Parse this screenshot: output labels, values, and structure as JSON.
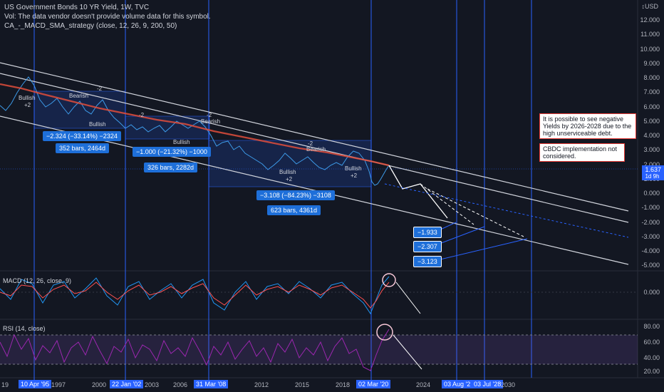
{
  "header": {
    "symbol_line": "US Government Bonds 10 YR Yield, 1W, TVC",
    "volume_line": "Vol: The data vendor doesn't provide volume data for this symbol.",
    "strategy_line": "CA_-_MACD_SMA_strategy (close, 12, 26, 9, 200, 50)"
  },
  "currency": "USD",
  "price_axis": [
    "12.000",
    "11.000",
    "10.000",
    "9.000",
    "8.000",
    "7.000",
    "6.000",
    "5.000",
    "4.000",
    "3.000",
    "2.000",
    "1.000",
    "0.000",
    "-1.000",
    "-2.000",
    "-3.000",
    "-4.000",
    "-5.000"
  ],
  "current_price": {
    "value": "1.637",
    "countdown": "1d 9h"
  },
  "macd": {
    "title": "MACD (12, 26, close, 9)",
    "axis_label": "0.000"
  },
  "rsi": {
    "title": "RSI (14, close)",
    "axis_labels": [
      "80.00",
      "60.00",
      "40.00",
      "20.00"
    ]
  },
  "time_axis": {
    "labels": [
      "1997",
      "2000",
      "2003",
      "2006",
      "2012",
      "2015",
      "2018",
      "2024",
      "2030"
    ],
    "partial_left": "19",
    "highlighted": [
      "10 Apr '95",
      "22 Jan '02",
      "31 Mar '08",
      "02 Mar '20",
      "03 Aug '2",
      "03 Jul '28"
    ]
  },
  "measurements": [
    {
      "range": "−2.324 (−33.14%) −2324",
      "bars": "352 bars, 2464d"
    },
    {
      "range": "−1.000 (−21.32%) −1000",
      "bars": "326 bars, 2282d"
    },
    {
      "range": "−3.108 (−84.23%) −3108",
      "bars": "623 bars, 4361d"
    }
  ],
  "targets": [
    "−1.933",
    "−2.307",
    "−3.123"
  ],
  "signals": {
    "bullish": "Bullish",
    "bearish": "Bearish",
    "plus2": "+2",
    "minus2": "-2"
  },
  "notes": {
    "negative_yields": "It is possible to see negative Yields by 2026-2028 due to the high unserviceable debt.",
    "cbdc": "CBDC implementation not considered."
  },
  "colors": {
    "background": "#131722",
    "accent": "#2962ff",
    "price_line": "#1e88e5",
    "sma": "#e04e3b",
    "macd_line": "#2196f3",
    "signal_line": "#ff5252",
    "rsi_line": "#9c27b0"
  }
}
